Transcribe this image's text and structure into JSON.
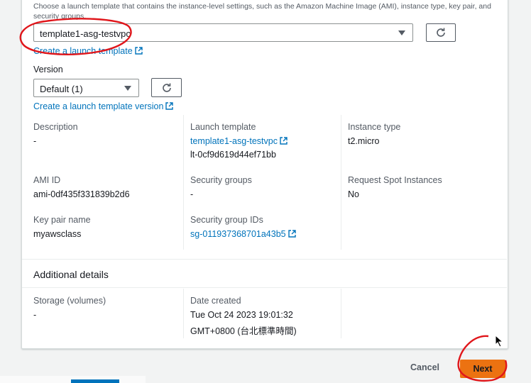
{
  "launch_template_section": {
    "description": "Choose a launch template that contains the instance-level settings, such as the Amazon Machine Image (AMI), instance type, key pair, and security groups.",
    "selected_template": "template1-asg-testvpc",
    "create_link": "Create a launch template"
  },
  "version": {
    "label": "Version",
    "selected": "Default (1)",
    "create_link": "Create a launch template version"
  },
  "details": {
    "description_label": "Description",
    "description_value": "-",
    "launch_template_label": "Launch template",
    "launch_template_name": "template1-asg-testvpc",
    "launch_template_id": "lt-0cf9d619d44ef71bb",
    "instance_type_label": "Instance type",
    "instance_type_value": "t2.micro",
    "ami_label": "AMI ID",
    "ami_value": "ami-0df435f331839b2d6",
    "security_groups_label": "Security groups",
    "security_groups_value": "-",
    "spot_label": "Request Spot Instances",
    "spot_value": "No",
    "keypair_label": "Key pair name",
    "keypair_value": "myawsclass",
    "sg_ids_label": "Security group IDs",
    "sg_ids_value": "sg-011937368701a43b5"
  },
  "additional": {
    "title": "Additional details",
    "storage_label": "Storage (volumes)",
    "storage_value": "-",
    "date_label": "Date created",
    "date_line1": "Tue Oct 24 2023 19:01:32",
    "date_line2": "GMT+0800 (台北標準時間)"
  },
  "footer": {
    "cancel": "Cancel",
    "next": "Next"
  },
  "colors": {
    "link": "#0073bb",
    "primary_button": "#ec7211",
    "annotation": "#e0161b"
  }
}
